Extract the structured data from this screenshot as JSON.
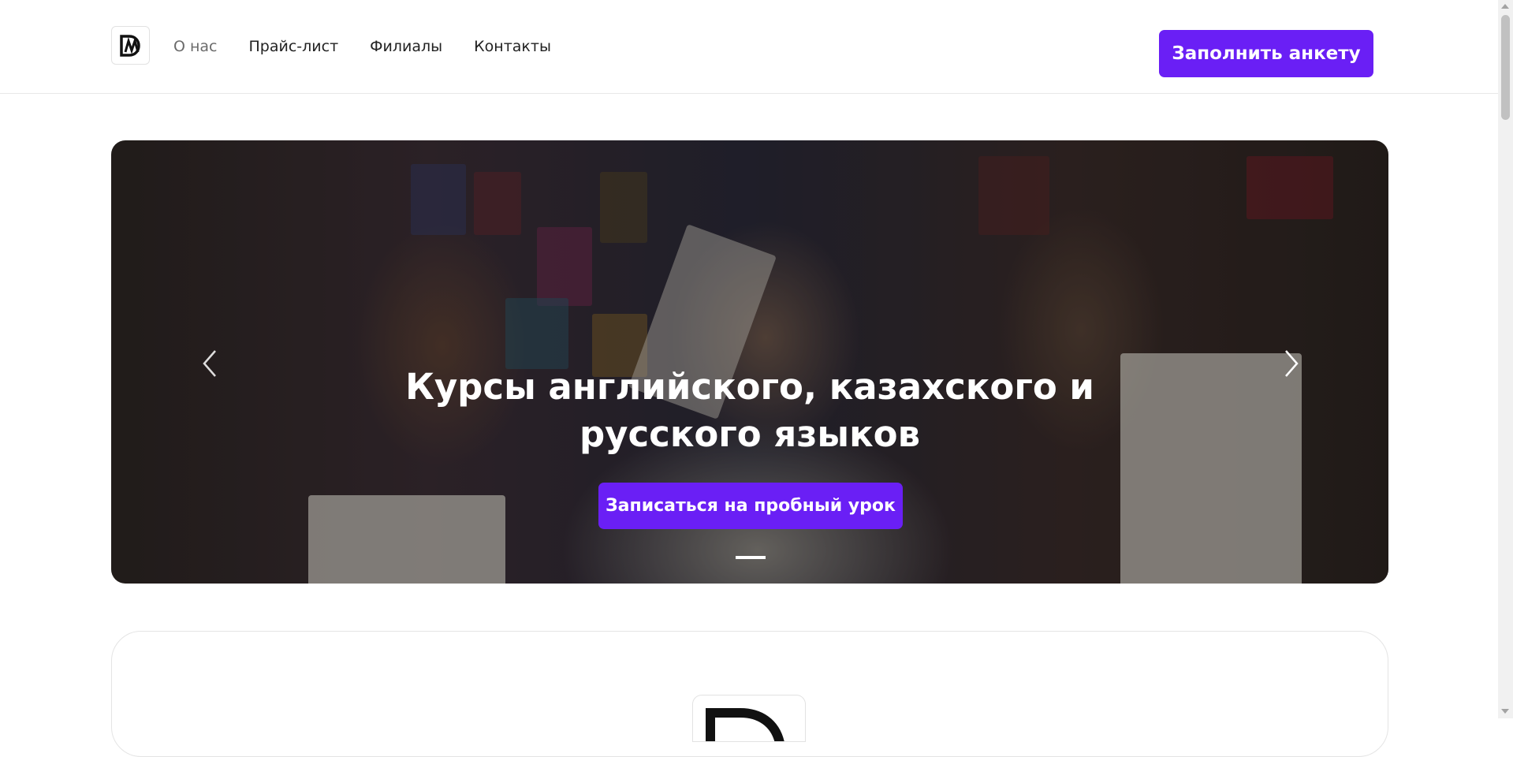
{
  "header": {
    "logo_icon": "brand-logo-icon",
    "nav": [
      {
        "label": "О нас",
        "active": true
      },
      {
        "label": "Прайс-лист",
        "active": false
      },
      {
        "label": "Филиалы",
        "active": false
      },
      {
        "label": "Контакты",
        "active": false
      }
    ],
    "cta_label": "Заполнить анкету"
  },
  "hero": {
    "title": "Курсы английского, казахского и русского языков",
    "button_label": "Записаться на пробный урок",
    "prev_icon": "chevron-left-icon",
    "next_icon": "chevron-right-icon",
    "active_slide": 1
  },
  "about": {
    "logo_icon": "brand-logo-icon"
  },
  "colors": {
    "accent": "#6a1ff5",
    "text": "#222222",
    "nav_active": "#6b6b6b"
  }
}
